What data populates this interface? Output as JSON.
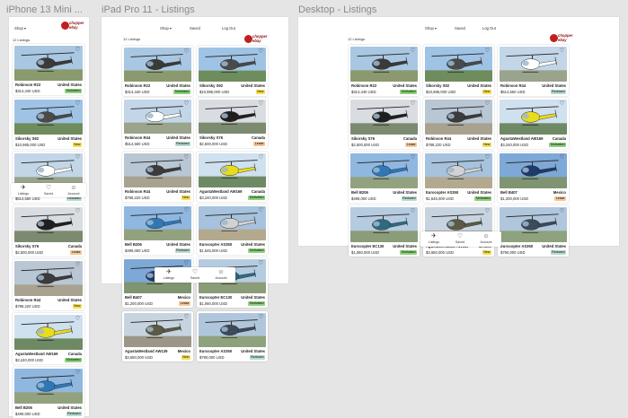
{
  "frame_titles": {
    "mobile": "iPhone 13 Mini ...",
    "ipad": "iPad Pro 11 - Listings",
    "desktop": "Desktop - Listings"
  },
  "header": {
    "menu_dropdown": "Shop",
    "saved": "Saved",
    "logout": "Log Out",
    "brand_line1": "chopper",
    "brand_line2": "ebay"
  },
  "listing_count": "12 Listings",
  "tabs": {
    "listings": "Listings",
    "saved": "Saved",
    "account": "Account"
  },
  "colors": {
    "badge_new": "#f7df55",
    "badge_reduced": "#b8dcd0",
    "badge_motivated": "#8fd27f",
    "badge_lease": "#f4c79a"
  },
  "icons": {
    "favorite": "heart-icon",
    "listings": "helicopter-icon",
    "saved": "heart-icon",
    "account": "person-icon"
  },
  "listings": [
    {
      "name": "Robinson R22",
      "location": "United States",
      "price": "$314,440 USD",
      "badge": "Motivated",
      "badge_type": "motivated"
    },
    {
      "name": "Sikorsky S92",
      "location": "United States",
      "price": "$10,985,000 USD",
      "badge": "New",
      "badge_type": "new"
    },
    {
      "name": "Robinson R44",
      "location": "United States",
      "price": "$514,560 USD",
      "badge": "Reduced",
      "badge_type": "reduced"
    },
    {
      "name": "Sikorsky S76",
      "location": "Canada",
      "price": "$2,500,000 USD",
      "badge": "Lease",
      "badge_type": "lease"
    },
    {
      "name": "Robinson R44",
      "location": "United States",
      "price": "$788,220 USD",
      "badge": "New",
      "badge_type": "new"
    },
    {
      "name": "AgustaWestland AW169",
      "location": "Canada",
      "price": "$3,240,000 USD",
      "badge": "Motivated",
      "badge_type": "motivated"
    },
    {
      "name": "Bell B206",
      "location": "United States",
      "price": "$499,000 USD",
      "badge": "Reduced",
      "badge_type": "reduced"
    },
    {
      "name": "Eurocopter AS350",
      "location": "United States",
      "price": "$1,545,000 USD",
      "badge": "Motivated",
      "badge_type": "motivated"
    },
    {
      "name": "Bell B407",
      "location": "Mexico",
      "price": "$1,200,000 USD",
      "badge": "Lease",
      "badge_type": "lease"
    },
    {
      "name": "Eurocopter EC130",
      "location": "United States",
      "price": "$1,060,000 USD",
      "badge": "Motivated",
      "badge_type": "motivated"
    },
    {
      "name": "AgustaWestland AW139",
      "location": "Mexico",
      "price": "$3,650,000 USD",
      "badge": "New",
      "badge_type": "new"
    },
    {
      "name": "Eurocopter AS350",
      "location": "United States",
      "price": "$790,000 USD",
      "badge": "Reduced",
      "badge_type": "reduced"
    }
  ]
}
